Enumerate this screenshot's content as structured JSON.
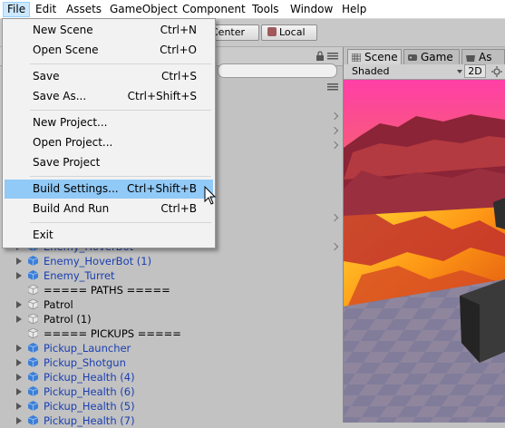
{
  "menubar": {
    "items": [
      "File",
      "Edit",
      "Assets",
      "GameObject",
      "Component",
      "Tools",
      "Window",
      "Help"
    ]
  },
  "toolbar": {
    "center_label": "Center",
    "local_label": "Local"
  },
  "file_menu": {
    "items": [
      {
        "label": "New Scene",
        "shortcut": "Ctrl+N"
      },
      {
        "label": "Open Scene",
        "shortcut": "Ctrl+O"
      },
      {
        "label": "Save",
        "shortcut": "Ctrl+S"
      },
      {
        "label": "Save As...",
        "shortcut": "Ctrl+Shift+S"
      },
      {
        "label": "New Project...",
        "shortcut": ""
      },
      {
        "label": "Open Project...",
        "shortcut": ""
      },
      {
        "label": "Save Project",
        "shortcut": ""
      },
      {
        "label": "Build Settings...",
        "shortcut": "Ctrl+Shift+B"
      },
      {
        "label": "Build And Run",
        "shortcut": "Ctrl+B"
      },
      {
        "label": "Exit",
        "shortcut": ""
      }
    ],
    "highlighted": "Build Settings..."
  },
  "hierarchy": {
    "rows": [
      {
        "label": "Enemy_HoverBot",
        "kind": "prefab"
      },
      {
        "label": "Enemy_HoverBot (1)",
        "kind": "prefab"
      },
      {
        "label": "Enemy_Turret",
        "kind": "prefab"
      },
      {
        "label": "===== PATHS =====",
        "kind": "plain"
      },
      {
        "label": "Patrol",
        "kind": "plain"
      },
      {
        "label": "Patrol (1)",
        "kind": "plain"
      },
      {
        "label": "===== PICKUPS =====",
        "kind": "plain"
      },
      {
        "label": "Pickup_Launcher",
        "kind": "prefab"
      },
      {
        "label": "Pickup_Shotgun",
        "kind": "prefab"
      },
      {
        "label": "Pickup_Health (4)",
        "kind": "prefab"
      },
      {
        "label": "Pickup_Health (6)",
        "kind": "prefab"
      },
      {
        "label": "Pickup_Health (5)",
        "kind": "prefab"
      },
      {
        "label": "Pickup_Health (7)",
        "kind": "prefab"
      }
    ]
  },
  "scene_panel": {
    "tabs": [
      "Scene",
      "Game",
      "As"
    ],
    "shading_mode": "Shaded",
    "mode_2d_label": "2D"
  },
  "colors": {
    "prefab_text": "#1a3fb0",
    "menu_highlight": "#91c9f7",
    "lava": "#f39a1a",
    "rock": "#9c2f3f"
  }
}
